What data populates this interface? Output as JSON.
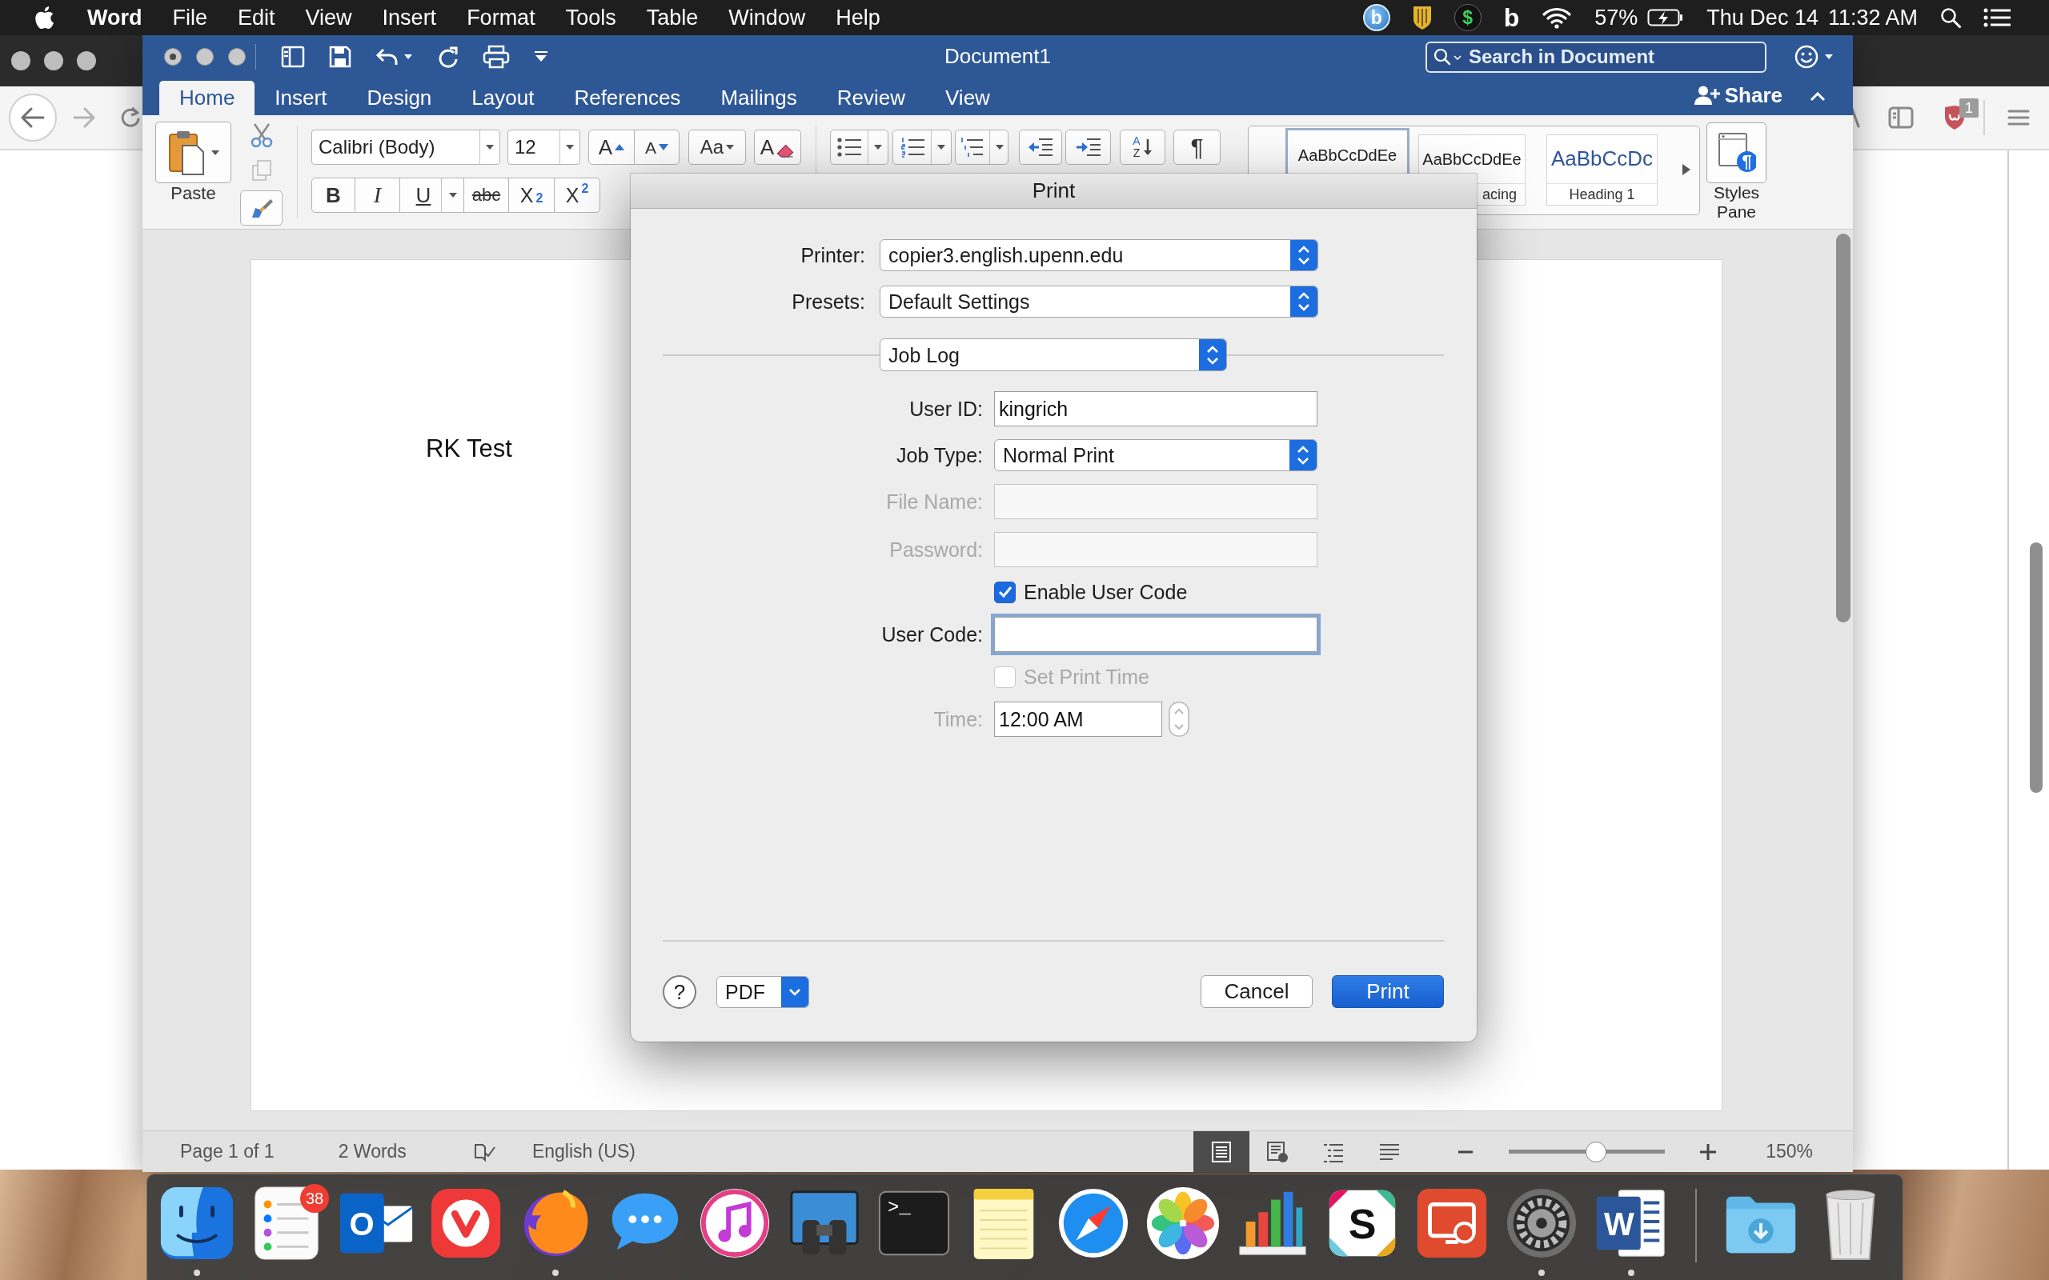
{
  "menu_bar": {
    "app_name": "Word",
    "menus": [
      "File",
      "Edit",
      "View",
      "Insert",
      "Format",
      "Tools",
      "Table",
      "Window",
      "Help"
    ],
    "extras": [
      {
        "kind": "letter-disc",
        "text": "b"
      },
      {
        "kind": "shield"
      },
      {
        "kind": "coin",
        "text": "$"
      },
      {
        "kind": "letter",
        "text": "b"
      },
      {
        "kind": "wifi"
      }
    ],
    "battery": "57%",
    "date": "Thu Dec 14",
    "time": "11:32 AM"
  },
  "browser_window": {
    "extension_badge": "1"
  },
  "word_window": {
    "title": "Document1",
    "edited": true,
    "search": {
      "placeholder": "Search in Document"
    },
    "share": "Share",
    "tabs": [
      {
        "label": "Home",
        "selected": true
      },
      {
        "label": "Insert",
        "selected": false
      },
      {
        "label": "Design",
        "selected": false
      },
      {
        "label": "Layout",
        "selected": false
      },
      {
        "label": "References",
        "selected": false
      },
      {
        "label": "Mailings",
        "selected": false
      },
      {
        "label": "Review",
        "selected": false
      },
      {
        "label": "View",
        "selected": false
      }
    ],
    "ribbon": {
      "paste": "Paste",
      "font_name": "Calibri (Body)",
      "font_size": "12",
      "font_buttons": [
        {
          "kind": "grow",
          "text": "A"
        },
        {
          "kind": "shrink",
          "text": "A"
        },
        {
          "kind": "case",
          "text": "Aa"
        },
        {
          "kind": "clear",
          "text": "A"
        }
      ],
      "format_buttons": [
        {
          "kind": "bold",
          "text": "B"
        },
        {
          "kind": "italic",
          "text": "I"
        },
        {
          "kind": "underline",
          "text": "U"
        },
        {
          "kind": "strike",
          "text": "abc"
        },
        {
          "kind": "subscript",
          "text": "X$_{2}$"
        },
        {
          "kind": "superscript",
          "text": "X$^{2}$"
        }
      ],
      "paragraph_buttons": [
        {
          "kind": "bullets"
        },
        {
          "kind": "numbering"
        },
        {
          "kind": "multilevel"
        },
        {
          "kind": "outdent"
        },
        {
          "kind": "indent"
        },
        {
          "kind": "sort",
          "letters": [
            "A",
            "Z"
          ]
        },
        {
          "kind": "marks",
          "text": "¶"
        }
      ],
      "styles": [
        {
          "kind": "plain",
          "sample": "AaBbCcDdEe",
          "selected": true
        },
        {
          "kind": "plain",
          "sample": "AaBbCcDdEe",
          "caption": "acing",
          "selected": false
        },
        {
          "kind": "heading",
          "sample": "AaBbCcDc",
          "caption": "Heading 1",
          "selected": false
        }
      ],
      "styles_pane": {
        "label": "Styles Pane",
        "glyph": "¶"
      }
    },
    "document": {
      "text": "RK Test"
    },
    "status_bar": {
      "page": "Page 1 of 1",
      "words": "2 Words",
      "language": "English (US)",
      "views": [
        {
          "kind": "print",
          "selected": true
        },
        {
          "kind": "web",
          "selected": false
        },
        {
          "kind": "outline",
          "selected": false
        },
        {
          "kind": "draft",
          "selected": false
        }
      ],
      "zoom": {
        "level": 0.56,
        "reading": "150%"
      }
    }
  },
  "print_dialog": {
    "title": "Print",
    "printer": {
      "label": "Printer:",
      "value": "copier3.english.upenn.edu"
    },
    "presets": {
      "label": "Presets:",
      "value": "Default Settings"
    },
    "section": "Job Log",
    "fields": [
      {
        "kind": "text",
        "label": "User ID:",
        "value": "kingrich",
        "disabled": false,
        "focused": false
      },
      {
        "kind": "select",
        "label": "Job Type:",
        "value": "Normal Print",
        "disabled": false,
        "focused": false
      },
      {
        "kind": "text",
        "label": "File Name:",
        "disabled": true,
        "focused": false
      },
      {
        "kind": "text",
        "label": "Password:",
        "disabled": true,
        "focused": false
      },
      {
        "kind": "checkbox",
        "label": "Enable User Code",
        "checked": true,
        "disabled": false,
        "focused": false
      },
      {
        "kind": "text",
        "label": "User Code:",
        "disabled": false,
        "focused": true
      },
      {
        "kind": "checkbox",
        "label": "Set Print Time",
        "checked": false,
        "disabled": true,
        "focused": false
      },
      {
        "kind": "stepper",
        "label": "Time:",
        "value": "12:00 AM",
        "disabled": true,
        "focused": false
      }
    ],
    "help": "?",
    "pdf": "PDF",
    "buttons": [
      {
        "kind": "default",
        "label": "Cancel"
      },
      {
        "kind": "primary",
        "label": "Print"
      }
    ]
  },
  "dock": {
    "apps": [
      {
        "kind": "face",
        "running": true
      },
      {
        "kind": "checklist",
        "badge": "38",
        "running": false
      },
      {
        "kind": "mail-tile",
        "letter": "O",
        "running": false
      },
      {
        "kind": "v-mark",
        "running": false
      },
      {
        "kind": "fox-globe",
        "running": true
      },
      {
        "kind": "speech-bubble",
        "running": false
      },
      {
        "kind": "music-note",
        "running": false
      },
      {
        "kind": "binoculars",
        "running": false
      },
      {
        "kind": "terminal",
        "letter": ">_",
        "running": false
      },
      {
        "kind": "notepad",
        "running": false
      },
      {
        "kind": "compass",
        "running": false
      },
      {
        "kind": "petals",
        "running": false
      },
      {
        "kind": "bar-chart",
        "running": false
      },
      {
        "kind": "letter-tile",
        "letter": "S",
        "running": false
      },
      {
        "kind": "remote-screen",
        "running": false
      },
      {
        "kind": "gear",
        "running": true
      },
      {
        "kind": "document",
        "letter": "W",
        "running": true
      }
    ],
    "stacks": [
      {
        "kind": "download-folder"
      },
      {
        "kind": "trash"
      }
    ]
  }
}
